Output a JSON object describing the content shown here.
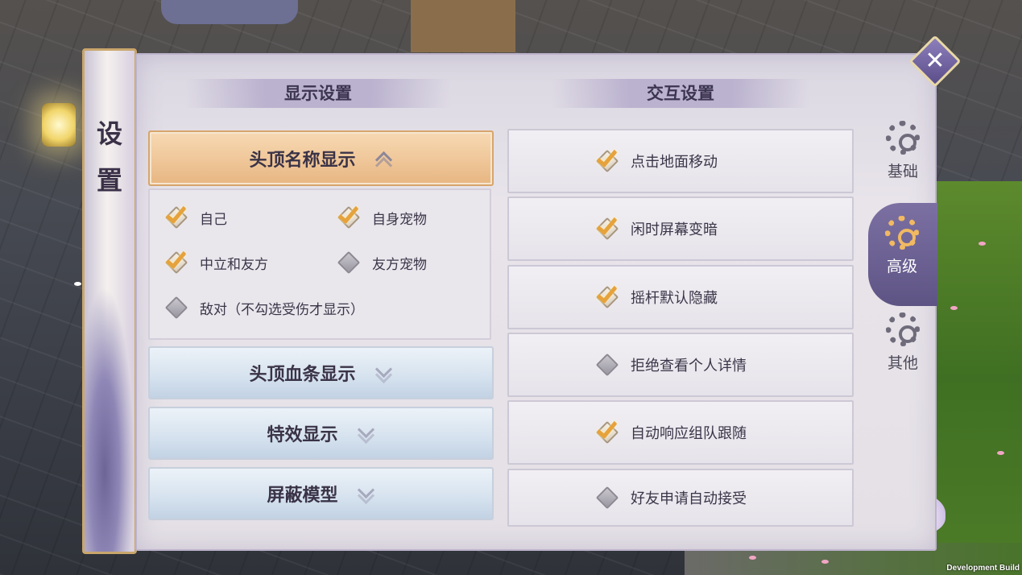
{
  "window": {
    "title": "设置",
    "build_label": "Development Build"
  },
  "left_section": {
    "title": "显示设置",
    "groups": [
      {
        "label": "头顶名称显示",
        "expanded": true
      },
      {
        "label": "头顶血条显示",
        "expanded": false
      },
      {
        "label": "特效显示",
        "expanded": false
      },
      {
        "label": "屏蔽模型",
        "expanded": false
      }
    ],
    "options": [
      {
        "label": "自己",
        "checked": true
      },
      {
        "label": "自身宠物",
        "checked": true
      },
      {
        "label": "中立和友方",
        "checked": true
      },
      {
        "label": "友方宠物",
        "checked": false
      },
      {
        "label": "敌对（不勾选受伤才显示）",
        "checked": false
      }
    ]
  },
  "right_section": {
    "title": "交互设置",
    "options": [
      {
        "label": "点击地面移动",
        "checked": true
      },
      {
        "label": "闲时屏幕变暗",
        "checked": true
      },
      {
        "label": "摇杆默认隐藏",
        "checked": true
      },
      {
        "label": "拒绝查看个人详情",
        "checked": false
      },
      {
        "label": "自动响应组队跟随",
        "checked": true
      },
      {
        "label": "好友申请自动接受",
        "checked": false
      }
    ]
  },
  "tabs": [
    {
      "label": "基础",
      "icon": "gear-icon",
      "active": false
    },
    {
      "label": "高级",
      "icon": "gear-advanced-icon",
      "active": true
    },
    {
      "label": "其他",
      "icon": "gear-other-icon",
      "active": false
    }
  ],
  "colors": {
    "accent_check": "#e6a23b",
    "active_tab": "#6b5f93",
    "expanded_header": "#f0c89b"
  }
}
